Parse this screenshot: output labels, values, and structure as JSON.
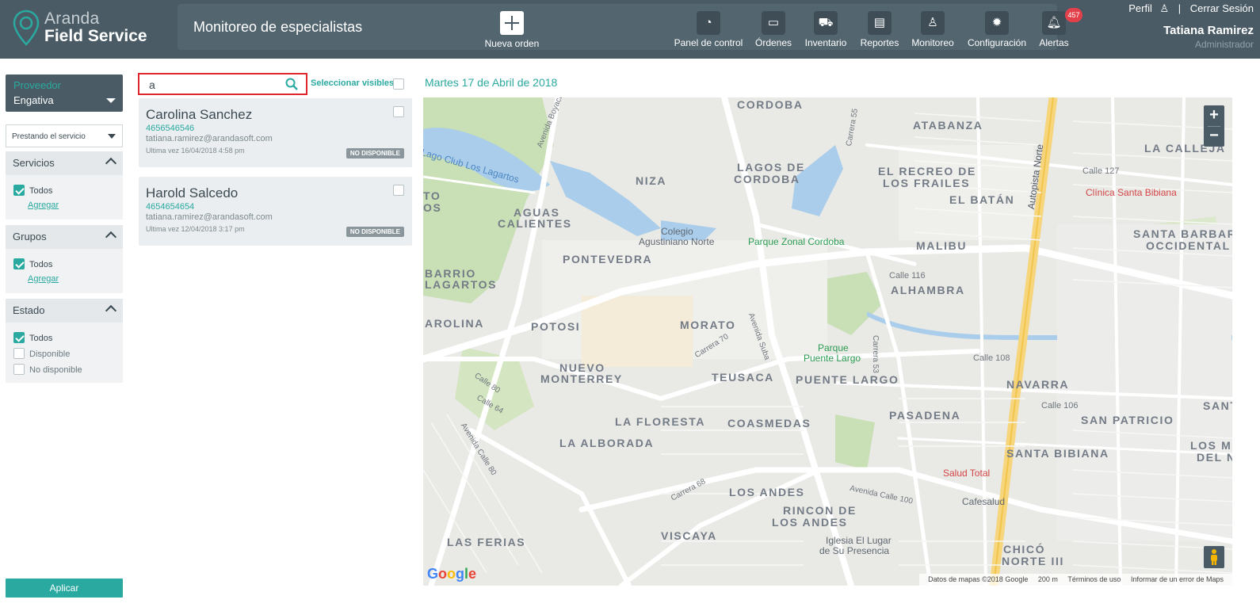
{
  "header": {
    "logo_line1": "Aranda",
    "logo_line2": "Field Service",
    "page_title": "Monitoreo de especialistas",
    "new_order_label": "Nueva orden",
    "nav": [
      {
        "label": "Panel de control",
        "icon": "dashboard-icon"
      },
      {
        "label": "Órdenes",
        "icon": "orders-icon"
      },
      {
        "label": "Inventario",
        "icon": "inventory-icon"
      },
      {
        "label": "Reportes",
        "icon": "reports-icon"
      },
      {
        "label": "Monitoreo",
        "icon": "monitor-icon"
      },
      {
        "label": "Configuración",
        "icon": "gear-icon"
      },
      {
        "label": "Alertas",
        "icon": "bell-icon",
        "badge": "457"
      }
    ],
    "profile_link": "Perfil",
    "logout_link": "Cerrar Sesión",
    "user_name": "Tatiana Ramirez",
    "user_role": "Administrador"
  },
  "filters": {
    "provider_label": "Proveedor",
    "provider_value": "Engativa",
    "status_select": "Prestando el servicio",
    "sections": [
      {
        "title": "Servicios",
        "all_label": "Todos",
        "add_label": "Agregar"
      },
      {
        "title": "Grupos",
        "all_label": "Todos",
        "add_label": "Agregar"
      },
      {
        "title": "Estado",
        "all_label": "Todos",
        "opt1": "Disponible",
        "opt2": "No disponible"
      }
    ],
    "apply_label": "Aplicar"
  },
  "list": {
    "search_value": "a",
    "select_visible_label": "Seleccionar visibles",
    "items": [
      {
        "name": "Carolina Sanchez",
        "phone": "4656546546",
        "email": "tatiana.ramirez@arandasoft.com",
        "last_seen": "Ultima vez 16/04/2018 4:58 pm",
        "status": "NO DISPONIBLE"
      },
      {
        "name": "Harold Salcedo",
        "phone": "4654654654",
        "email": "tatiana.ramirez@arandasoft.com",
        "last_seen": "Ultima vez 12/04/2018 3:17 pm",
        "status": "NO DISPONIBLE"
      }
    ]
  },
  "map": {
    "date_label": "Martes 17 de Abril de 2018",
    "neighborhoods": [
      "CORDOBA",
      "ATABANZA",
      "LA CALLEJA",
      "NIZA",
      "LAGOS DE",
      "CORDOBA",
      "EL RECREO DE",
      "LOS FRAILES",
      "EL BATÁN",
      "AGUAS",
      "CALIENTES",
      "SANTA BARBARA",
      "OCCIDENTAL",
      "MALIBU",
      "PONTEVEDRA",
      "ALHAMBRA",
      "BARRIO",
      "LAGARTOS",
      "AROLINA",
      "POTOSI",
      "MORATO",
      "NUEVO",
      "MONTERREY",
      "TEUSACA",
      "PUENTE LARGO",
      "NAVARRA",
      "SANT",
      "PASADENA",
      "SAN PATRICIO",
      "LA FLORESTA",
      "COASMEDAS",
      "LOS MO",
      "DEL NO",
      "LA ALBORADA",
      "SANTA BIBIANA",
      "LOS ANDES",
      "RINCON DE",
      "LOS ANDES",
      "VISCAYA",
      "LAS FERIAS",
      "CHICÓ",
      "NORTE III",
      "TO",
      "OS"
    ],
    "pois": [
      "Colegio",
      "Agustiniano Norte",
      "Parque Zonal Cordoba",
      "Parque",
      "Puente Largo",
      "Clínica Santa Bibiana",
      "Salud Total",
      "Cafesalud",
      "Iglesia El Lugar",
      "de Su Presencia",
      "Lago Club Los Lagartos"
    ],
    "roads": [
      "Autopista Norte",
      "Avenida Boyacá",
      "Avenida Suba",
      "Calle 116",
      "Calle 127",
      "Avenida Calle 100",
      "Calle 108",
      "Carrera 70",
      "Carrera 68",
      "Avenida Calle 80",
      "Calle 80",
      "Calle 64",
      "Carrera 53",
      "Carrera 55",
      "Calle 106"
    ],
    "zoom_in": "+",
    "zoom_out": "−",
    "google": [
      "G",
      "o",
      "o",
      "g",
      "l",
      "e"
    ],
    "attribution": {
      "data": "Datos de mapas ©2018 Google",
      "scale": "200 m",
      "terms": "Términos de uso",
      "report": "Informar de un error de Maps"
    }
  }
}
